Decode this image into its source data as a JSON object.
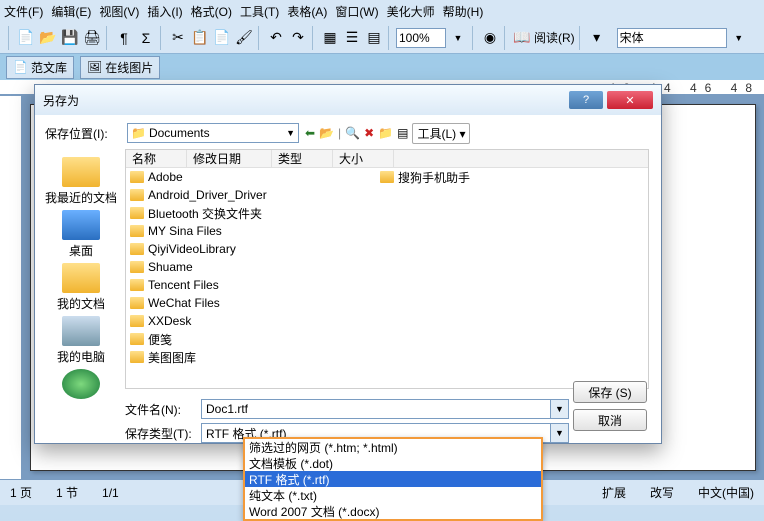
{
  "menubar": {
    "file": "文件(F)",
    "edit": "编辑(E)",
    "view": "视图(V)",
    "insert": "插入(I)",
    "format": "格式(O)",
    "tools": "工具(T)",
    "table": "表格(A)",
    "window": "窗口(W)",
    "beauty": "美化大师",
    "help": "帮助(H)"
  },
  "toolbar": {
    "zoom": "100%",
    "font": "宋体",
    "read": "阅读(R)"
  },
  "secondary": {
    "lib": "范文库",
    "pic": "在线图片"
  },
  "ruler": "42  44  46  48",
  "status": {
    "page": "1 页",
    "section": "1 节",
    "frac": "1/1",
    "ext": "扩展",
    "rev": "改写",
    "lang": "中文(中国)"
  },
  "dialog": {
    "title": "另存为",
    "loc_label": "保存位置(I):",
    "loc_value": "Documents",
    "tools": "工具(L)",
    "headers": {
      "name": "名称",
      "date": "修改日期",
      "type": "类型",
      "size": "大小"
    },
    "folders_left": [
      "Adobe",
      "Android_Driver_Driver",
      "Bluetooth 交换文件夹",
      "MY Sina Files",
      "QiyiVideoLibrary",
      "Shuame",
      "Tencent Files",
      "WeChat Files",
      "XXDesk",
      "便笺",
      "美图图库"
    ],
    "folders_right": [
      "搜狗手机助手"
    ],
    "places": {
      "recent": "我最近的文档",
      "desktop": "桌面",
      "mydocs": "我的文档",
      "mycomp": "我的电脑"
    },
    "fn_label": "文件名(N):",
    "fn_value": "Doc1.rtf",
    "ft_label": "保存类型(T):",
    "ft_value": "RTF 格式 (*.rtf)",
    "save": "保存 (S)",
    "cancel": "取消"
  },
  "dropdown": {
    "items": [
      "筛选过的网页 (*.htm; *.html)",
      "文档模板 (*.dot)",
      "RTF 格式 (*.rtf)",
      "纯文本 (*.txt)",
      "Word 2007 文档 (*.docx)"
    ],
    "selected_index": 2
  }
}
